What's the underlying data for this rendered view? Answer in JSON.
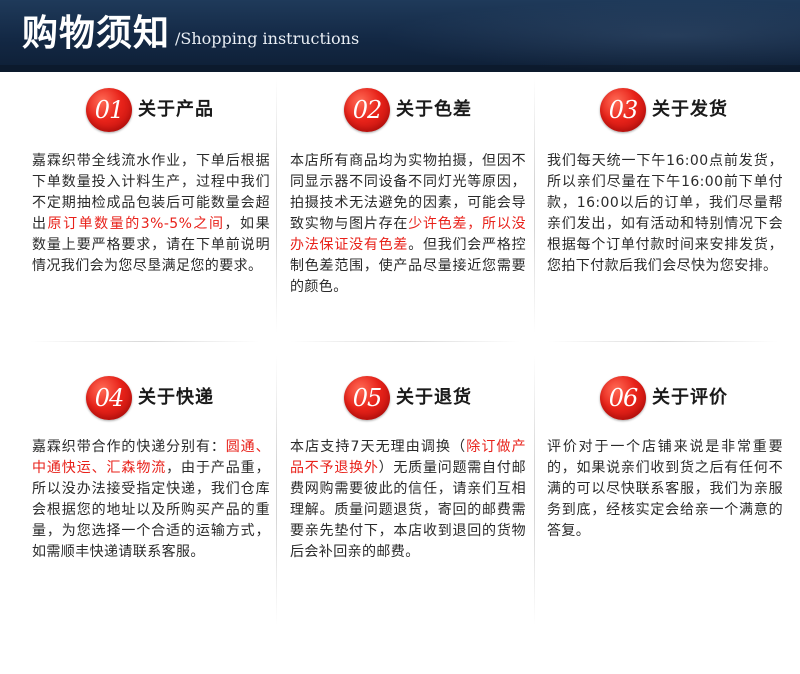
{
  "header": {
    "title": "购物须知",
    "subtitle": "/Shopping instructions"
  },
  "colors": {
    "header_bg": "#132844",
    "accent": "#e8211a"
  },
  "cards": [
    {
      "number": "01",
      "title": "关于产品",
      "body": [
        {
          "text": "嘉霖织带全线流水作业，下单后根据下单数量投入计料生产，过程中我们不定期抽检成品包装后可能数量会超出",
          "hl": false
        },
        {
          "text": "原订单数量的3%-5%之间",
          "hl": true
        },
        {
          "text": "，如果数量上要严格要求，请在下单前说明情况我们会为您尽垦满足您的要求。",
          "hl": false
        }
      ]
    },
    {
      "number": "02",
      "title": "关于色差",
      "body": [
        {
          "text": "本店所有商品均为实物拍摄，但因不同显示器不同设备不同灯光等原因，拍摄技术无法避免的因素，可能会导致实物与图片存在",
          "hl": false
        },
        {
          "text": "少许色差，所以没办法保证没有色差",
          "hl": true
        },
        {
          "text": "。但我们会严格控制色差范围，使产品尽量接近您需要的颜色。",
          "hl": false
        }
      ]
    },
    {
      "number": "03",
      "title": "关于发货",
      "body": [
        {
          "text": "我们每天统一下午16:00点前发货，所以亲们尽量在下午16:00前下单付款，16:00以后的订单，我们尽量帮亲们发出，如有活动和特别情况下会根据每个订单付款时间来安排发货，您拍下付款后我们会尽快为您安排。",
          "hl": false
        }
      ]
    },
    {
      "number": "04",
      "title": "关于快递",
      "body": [
        {
          "text": "嘉霖织带合作的快递分别有：",
          "hl": false
        },
        {
          "text": "圆通、中通快运、汇森物流",
          "hl": true
        },
        {
          "text": "，由于产品重，所以没办法接受指定快递，我们仓库会根据您的地址以及所购买产品的重量，为您选择一个合适的运输方式，如需顺丰快递请联系客服。",
          "hl": false
        }
      ]
    },
    {
      "number": "05",
      "title": "关于退货",
      "body": [
        {
          "text": "本店支持7天无理由调换（",
          "hl": false
        },
        {
          "text": "除订做产品不予退换外",
          "hl": true
        },
        {
          "text": "）无质量问题需自付邮费网购需要彼此的信任，请亲们互相理解。质量问题退货，寄回的邮费需要亲先垫付下，本店收到退回的货物后会补回亲的邮费。",
          "hl": false
        }
      ]
    },
    {
      "number": "06",
      "title": "关于评价",
      "body": [
        {
          "text": "评价对于一个店铺来说是非常重要的，如果说亲们收到货之后有任何不满的可以尽快联系客服，我们为亲服务到底，经核实定会给亲一个满意的答复。",
          "hl": false
        }
      ]
    }
  ]
}
